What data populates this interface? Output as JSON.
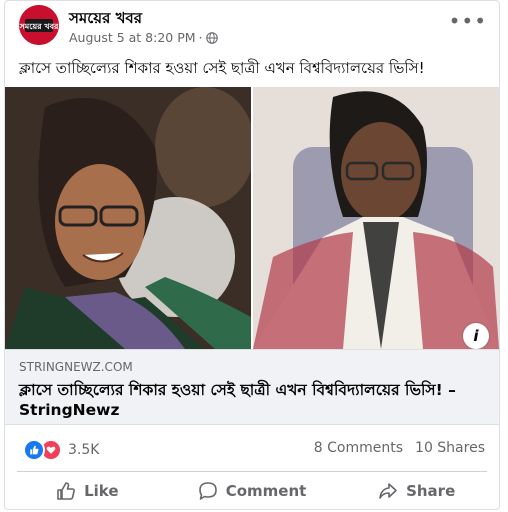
{
  "post": {
    "page_name": "সময়ের খবর",
    "avatar_text": "সময়ের খবর",
    "date": "August 5 at 8:20 PM",
    "separator": "·",
    "text": "ক্লাসে তাচ্ছিল্যের শিকার হওয়া সেই ছাত্রী এখন বিশ্ববিদ্যালয়ের ভিসি!"
  },
  "link": {
    "domain": "STRINGNEWZ.COM",
    "title": "ক্লাসে তাচ্ছিল্যের শিকার হওয়া সেই ছাত্রী এখন বিশ্ববিদ্যালয়ের ভিসি! – StringNewz"
  },
  "stats": {
    "reactions": "3.5K",
    "comments": "8 Comments",
    "shares": "10 Shares"
  },
  "actions": {
    "like": "Like",
    "comment": "Comment",
    "share": "Share"
  },
  "icons": {
    "more": "more-options-icon",
    "globe": "globe-icon",
    "info": "info-icon",
    "like_reaction": "like-reaction-icon",
    "love_reaction": "love-reaction-icon"
  },
  "colors": {
    "accent": "#1877f2",
    "love": "#f33e58",
    "muted": "#65676b"
  }
}
